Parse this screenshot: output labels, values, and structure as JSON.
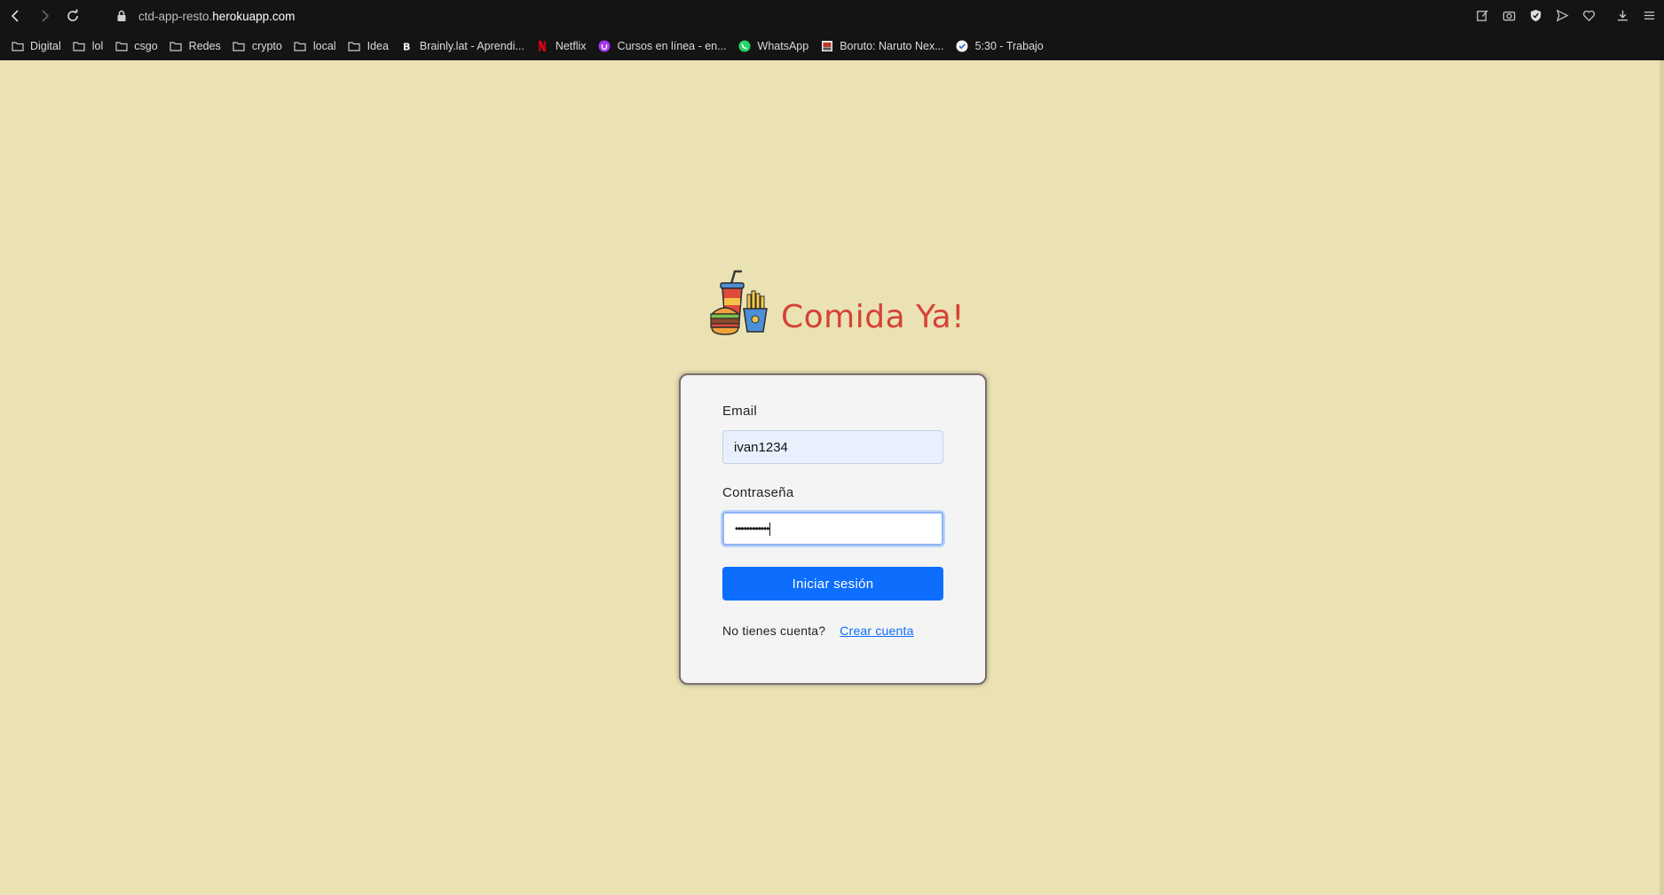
{
  "browser": {
    "url_prefix": "ctd-app-resto.",
    "url_host": "herokuapp.com",
    "bookmarks": [
      {
        "label": "Digital",
        "icon": "folder-icon"
      },
      {
        "label": "lol",
        "icon": "folder-icon"
      },
      {
        "label": "csgo",
        "icon": "folder-icon"
      },
      {
        "label": "Redes",
        "icon": "folder-icon"
      },
      {
        "label": "crypto",
        "icon": "folder-icon"
      },
      {
        "label": "local",
        "icon": "folder-icon"
      },
      {
        "label": "Idea",
        "icon": "folder-icon"
      },
      {
        "label": "Brainly.lat - Aprendi...",
        "icon": "brainly-icon"
      },
      {
        "label": "Netflix",
        "icon": "netflix-icon"
      },
      {
        "label": "Cursos en línea - en...",
        "icon": "udemy-icon"
      },
      {
        "label": "WhatsApp",
        "icon": "whatsapp-icon"
      },
      {
        "label": "Boruto: Naruto Nex...",
        "icon": "boruto-icon"
      },
      {
        "label": "5:30 - Trabajo",
        "icon": "check-circle-icon"
      }
    ]
  },
  "app": {
    "brand": "Comida Ya!",
    "logo_icon": "burger-drink-fries-icon"
  },
  "login": {
    "email_label": "Email",
    "email_value": "ivan1234",
    "password_label": "Contraseña",
    "password_masked": "••••••••••••",
    "submit_label": "Iniciar sesión",
    "no_account_text": "No tienes cuenta?",
    "create_account_link": "Crear cuenta"
  },
  "colors": {
    "page_bg": "#ebe2b4",
    "brand": "#d64236",
    "primary": "#0d6efd"
  }
}
